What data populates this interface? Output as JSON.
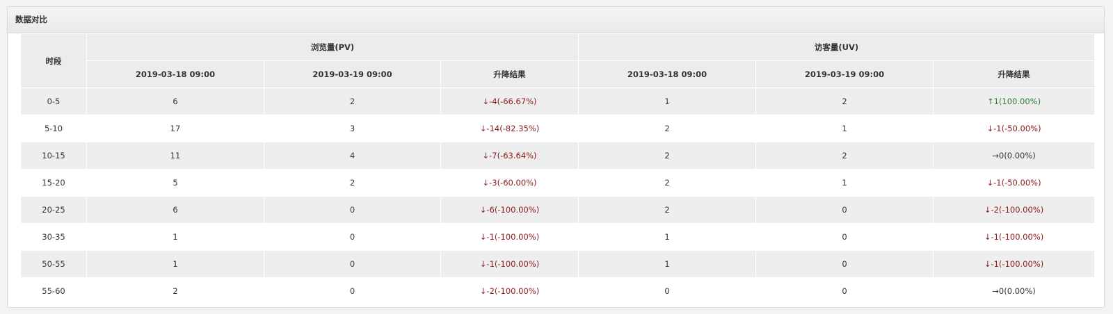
{
  "panel": {
    "title": "数据对比"
  },
  "table": {
    "period_header": "时段",
    "pv_group_header": "浏览量(PV)",
    "uv_group_header": "访客量(UV)",
    "sub_headers": {
      "pv_date1": "2019-03-18 09:00",
      "pv_date2": "2019-03-19 09:00",
      "pv_change": "升降结果",
      "uv_date1": "2019-03-18 09:00",
      "uv_date2": "2019-03-19 09:00",
      "uv_change": "升降结果"
    },
    "rows": [
      {
        "period": "0-5",
        "pv1": "6",
        "pv2": "2",
        "pv_change": "↓-4(-66.67%)",
        "pv_trend": "down",
        "uv1": "1",
        "uv2": "2",
        "uv_change": "↑1(100.00%)",
        "uv_trend": "up"
      },
      {
        "period": "5-10",
        "pv1": "17",
        "pv2": "3",
        "pv_change": "↓-14(-82.35%)",
        "pv_trend": "down",
        "uv1": "2",
        "uv2": "1",
        "uv_change": "↓-1(-50.00%)",
        "uv_trend": "down"
      },
      {
        "period": "10-15",
        "pv1": "11",
        "pv2": "4",
        "pv_change": "↓-7(-63.64%)",
        "pv_trend": "down",
        "uv1": "2",
        "uv2": "2",
        "uv_change": "→0(0.00%)",
        "uv_trend": "flat"
      },
      {
        "period": "15-20",
        "pv1": "5",
        "pv2": "2",
        "pv_change": "↓-3(-60.00%)",
        "pv_trend": "down",
        "uv1": "2",
        "uv2": "1",
        "uv_change": "↓-1(-50.00%)",
        "uv_trend": "down"
      },
      {
        "period": "20-25",
        "pv1": "6",
        "pv2": "0",
        "pv_change": "↓-6(-100.00%)",
        "pv_trend": "down",
        "uv1": "2",
        "uv2": "0",
        "uv_change": "↓-2(-100.00%)",
        "uv_trend": "down"
      },
      {
        "period": "30-35",
        "pv1": "1",
        "pv2": "0",
        "pv_change": "↓-1(-100.00%)",
        "pv_trend": "down",
        "uv1": "1",
        "uv2": "0",
        "uv_change": "↓-1(-100.00%)",
        "uv_trend": "down"
      },
      {
        "period": "50-55",
        "pv1": "1",
        "pv2": "0",
        "pv_change": "↓-1(-100.00%)",
        "pv_trend": "down",
        "uv1": "1",
        "uv2": "0",
        "uv_change": "↓-1(-100.00%)",
        "uv_trend": "down"
      },
      {
        "period": "55-60",
        "pv1": "2",
        "pv2": "0",
        "pv_change": "↓-2(-100.00%)",
        "pv_trend": "down",
        "uv1": "0",
        "uv2": "0",
        "uv_change": "→0(0.00%)",
        "uv_trend": "flat"
      }
    ]
  },
  "colors": {
    "down": "#8b1a1a",
    "up": "#2e7d32",
    "flat": "#333333"
  }
}
